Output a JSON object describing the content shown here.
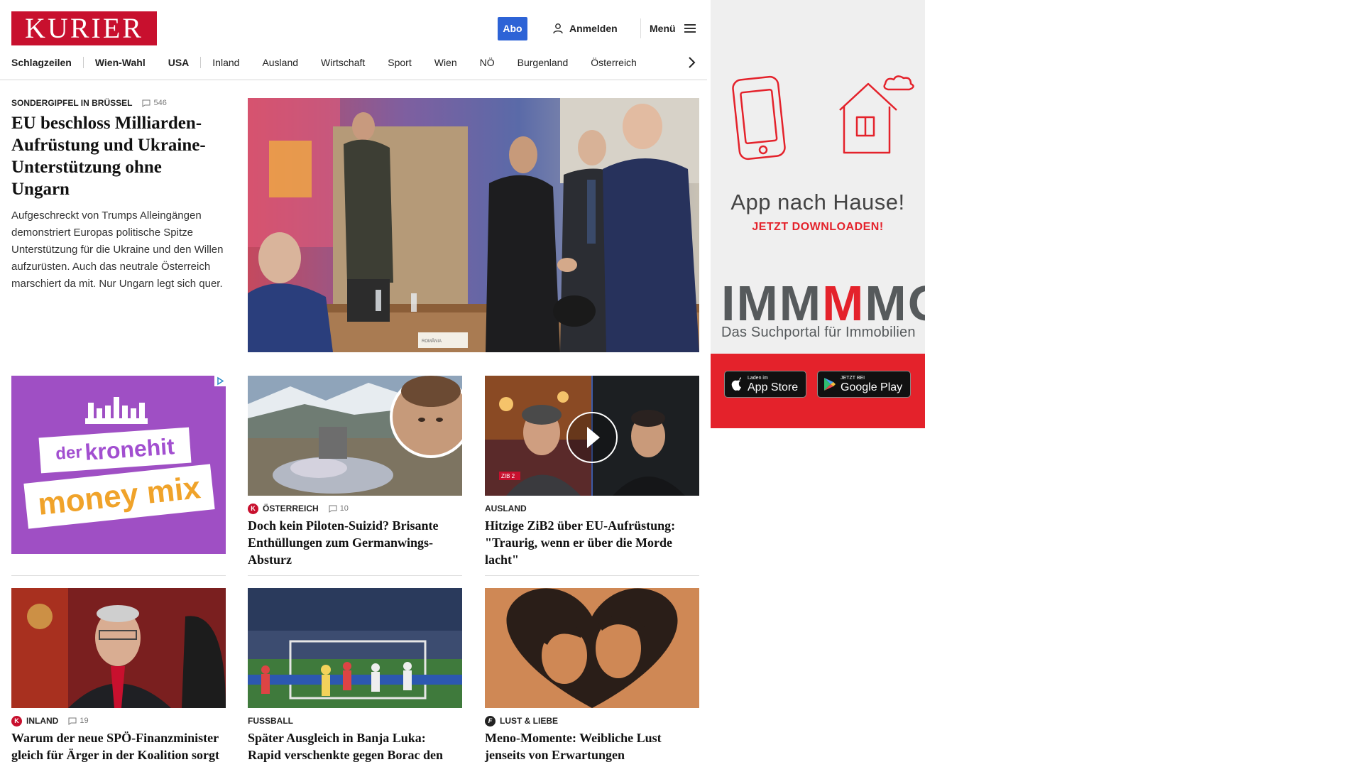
{
  "header": {
    "logo": "KURIER",
    "abo_label": "Abo",
    "login_label": "Anmelden",
    "menu_label": "Menü",
    "nav": [
      "Schlagzeilen",
      "Wien-Wahl",
      "USA",
      "Inland",
      "Ausland",
      "Wirtschaft",
      "Sport",
      "Wien",
      "NÖ",
      "Burgenland",
      "Österreich"
    ]
  },
  "lead": {
    "kicker": "SONDERGIPFEL IN BRÜSSEL",
    "comments": "546",
    "title": "EU beschloss Milliarden-Aufrüstung und Ukraine-Unterstützung ohne Ungarn",
    "teaser": "Aufgeschreckt von Trumps Alleingängen demonstriert Europas politische Spitze Unterstützung für die Ukraine und den Willen aufzurüsten. Auch das neutrale Österreich marschiert da mit. Nur Ungarn legt sich quer.",
    "nameplate": "ROMÂNIA"
  },
  "ad_left": {
    "line1_a": "der",
    "line1_b": "kronehit",
    "line2": "money mix"
  },
  "cards": [
    {
      "kicker": "ÖSTERREICH",
      "comments": "10",
      "title": "Doch kein Piloten-Suizid? Brisante Enthüllungen zum Germanwings-Absturz",
      "badge": "K"
    },
    {
      "kicker": "AUSLAND",
      "title": "Hitzige ZiB2 über EU-Aufrüstung: \"Traurig, wenn er über die Morde lacht\"",
      "tv_logo": "ZIB 2"
    },
    {
      "kicker": "INLAND",
      "comments": "19",
      "title": "Warum der neue SPÖ-Finanzminister gleich für Ärger in der Koalition sorgt",
      "badge": "K"
    },
    {
      "kicker": "FUSSBALL",
      "title": "Später Ausgleich in Banja Luka: Rapid verschenkte gegen Borac den Sieg"
    },
    {
      "kicker": "LUST & LIEBE",
      "title": "Meno-Momente: Weibliche Lust jenseits von Erwartungen",
      "badge": "f"
    }
  ],
  "side_ad": {
    "title": "App nach Hause!",
    "subtitle": "JETZT DOWNLOADEN!",
    "brand_a": "IMM",
    "brand_b": "M",
    "brand_c": "MO",
    "brand_sub": "Das Suchportal für Immobilien",
    "appstore_small": "Laden im",
    "appstore_big": "App Store",
    "gplay_small": "JETZT BEI",
    "gplay_big": "Google Play"
  },
  "colors": {
    "brand_red": "#c8102e",
    "abo_blue": "#2d63d6",
    "ad_purple": "#9f4fc4",
    "immmo_red": "#e4222b"
  }
}
